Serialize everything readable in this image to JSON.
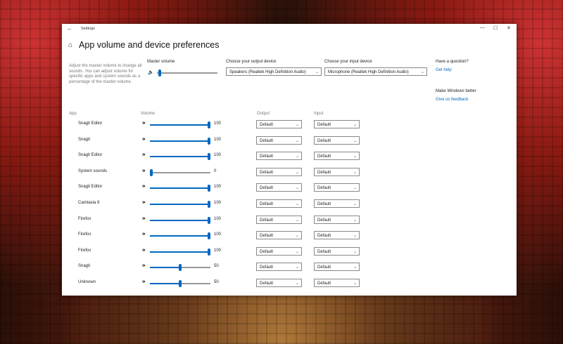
{
  "window": {
    "title": "Settings",
    "controls": {
      "minimize": "—",
      "maximize": "☐",
      "close": "✕"
    },
    "back_glyph": "←"
  },
  "page": {
    "home_glyph": "⌂",
    "title": "App volume and device preferences",
    "description": "Adjust the master volume to change all sounds. You can adjust volume for specific apps and system sounds as a percentage of the master volume."
  },
  "master": {
    "label": "Master volume",
    "level": 0.03,
    "speaker_glyph": "🔈"
  },
  "output_device": {
    "label": "Choose your output device",
    "value": "Speakers (Realtek High Definition Audio)"
  },
  "input_device": {
    "label": "Choose your input device",
    "value": "Microphone (Realtek High Definition Audio)"
  },
  "help": {
    "question": "Have a question?",
    "get_help": "Get help",
    "better": "Make Windows better",
    "feedback": "Give us feedback"
  },
  "columns": {
    "app": "App",
    "volume": "Volume",
    "output": "Output",
    "input": "Input"
  },
  "chevron": "⌄",
  "speaker_glyph": "🕪",
  "accent_color": "#0067c0",
  "apps": [
    {
      "name": "Snagit Editor",
      "volume": "100",
      "output": "Default",
      "input": "Default"
    },
    {
      "name": "Snagit",
      "volume": "100",
      "output": "Default",
      "input": "Default"
    },
    {
      "name": "Snagit Editor",
      "volume": "100",
      "output": "Default",
      "input": "Default"
    },
    {
      "name": "System sounds",
      "volume": "0",
      "output": "Default",
      "input": "Default"
    },
    {
      "name": "Snagit Editor",
      "volume": "100",
      "output": "Default",
      "input": "Default"
    },
    {
      "name": "Camtasia 9",
      "volume": "100",
      "output": "Default",
      "input": "Default"
    },
    {
      "name": "Firefox",
      "volume": "100",
      "output": "Default",
      "input": "Default"
    },
    {
      "name": "Firefox",
      "volume": "100",
      "output": "Default",
      "input": "Default"
    },
    {
      "name": "Firefox",
      "volume": "100",
      "output": "Default",
      "input": "Default"
    },
    {
      "name": "Snagit",
      "volume": "50",
      "output": "Default",
      "input": "Default"
    },
    {
      "name": "Unknown",
      "volume": "50",
      "output": "Default",
      "input": "Default"
    }
  ]
}
